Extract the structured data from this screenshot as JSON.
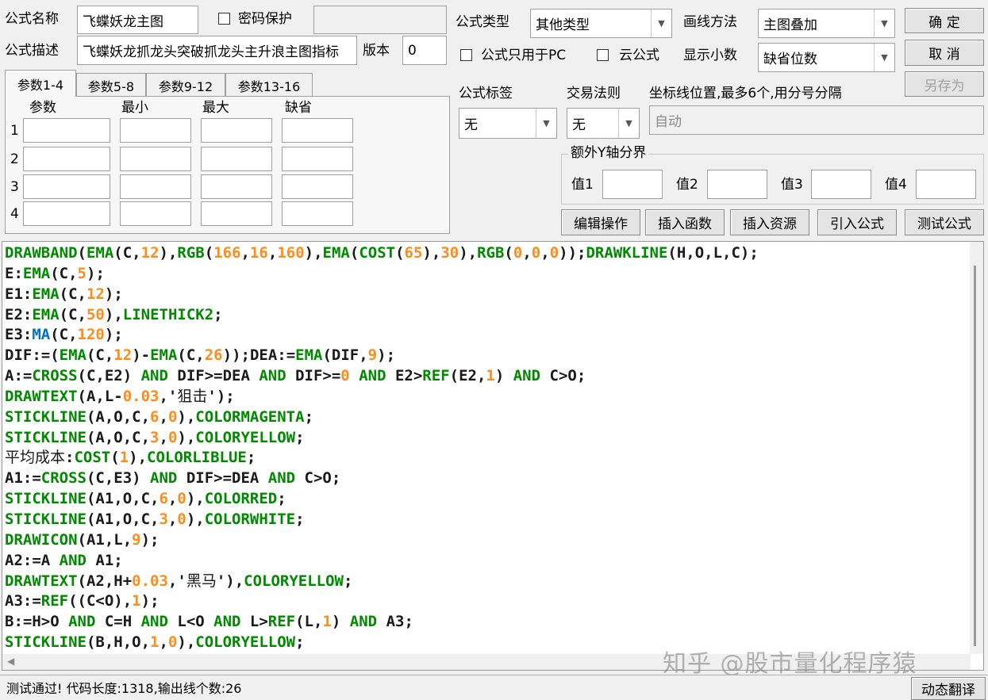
{
  "header": {
    "formula_name_label": "公式名称",
    "formula_name_value": "飞蝶妖龙主图",
    "password_label": "密码保护",
    "password_value": "",
    "formula_desc_label": "公式描述",
    "formula_desc_value": "飞蝶妖龙抓龙头突破抓龙头主升浪主图指标",
    "version_label": "版本",
    "version_value": "0",
    "formula_type_label": "公式类型",
    "formula_type_value": "其他类型",
    "draw_method_label": "画线方法",
    "draw_method_value": "主图叠加",
    "pc_only_label": "公式只用于PC",
    "cloud_label": "云公式",
    "decimal_label": "显示小数",
    "decimal_value": "缺省位数"
  },
  "buttons": {
    "ok": "确  定",
    "cancel": "取  消",
    "save_as": "另存为",
    "edit_ops": "编辑操作",
    "insert_func": "插入函数",
    "insert_res": "插入资源",
    "import_formula": "引入公式",
    "test_formula": "测试公式",
    "dynamic_translate": "动态翻译"
  },
  "params": {
    "tabs": [
      "参数1-4",
      "参数5-8",
      "参数9-12",
      "参数13-16"
    ],
    "headers": [
      "参数",
      "最小",
      "最大",
      "缺省"
    ],
    "rows": [
      "1",
      "2",
      "3",
      "4"
    ]
  },
  "right": {
    "tag_label": "公式标签",
    "tag_value": "无",
    "rule_label": "交易法则",
    "rule_value": "无",
    "axis_label": "坐标线位置,最多6个,用分号分隔",
    "axis_value": "自动",
    "extra_y_label": "额外Y轴分界",
    "value_labels": [
      "值1",
      "值2",
      "值3",
      "值4"
    ]
  },
  "code_lines": [
    [
      [
        "k",
        "DRAWBAND"
      ],
      [
        "t",
        "("
      ],
      [
        "k",
        "EMA"
      ],
      [
        "t",
        "(C,"
      ],
      [
        "n",
        "12"
      ],
      [
        "t",
        "),"
      ],
      [
        "k",
        "RGB"
      ],
      [
        "t",
        "("
      ],
      [
        "n",
        "166"
      ],
      [
        "t",
        ","
      ],
      [
        "n",
        "16"
      ],
      [
        "t",
        ","
      ],
      [
        "n",
        "160"
      ],
      [
        "t",
        "),"
      ],
      [
        "k",
        "EMA"
      ],
      [
        "t",
        "("
      ],
      [
        "k",
        "COST"
      ],
      [
        "t",
        "("
      ],
      [
        "n",
        "65"
      ],
      [
        "t",
        "),"
      ],
      [
        "n",
        "30"
      ],
      [
        "t",
        "),"
      ],
      [
        "k",
        "RGB"
      ],
      [
        "t",
        "("
      ],
      [
        "n",
        "0"
      ],
      [
        "t",
        ","
      ],
      [
        "n",
        "0"
      ],
      [
        "t",
        ","
      ],
      [
        "n",
        "0"
      ],
      [
        "t",
        "));"
      ],
      [
        "k",
        "DRAWKLINE"
      ],
      [
        "t",
        "(H,O,L,C);"
      ]
    ],
    [
      [
        "t",
        "E:"
      ],
      [
        "k",
        "EMA"
      ],
      [
        "t",
        "(C,"
      ],
      [
        "n",
        "5"
      ],
      [
        "t",
        ");"
      ]
    ],
    [
      [
        "t",
        "E1:"
      ],
      [
        "k",
        "EMA"
      ],
      [
        "t",
        "(C,"
      ],
      [
        "n",
        "12"
      ],
      [
        "t",
        ");"
      ]
    ],
    [
      [
        "t",
        "E2:"
      ],
      [
        "k",
        "EMA"
      ],
      [
        "t",
        "(C,"
      ],
      [
        "n",
        "50"
      ],
      [
        "t",
        "),"
      ],
      [
        "k",
        "LINETHICK2"
      ],
      [
        "t",
        ";"
      ]
    ],
    [
      [
        "t",
        "E3:"
      ],
      [
        "b",
        "MA"
      ],
      [
        "t",
        "(C,"
      ],
      [
        "n",
        "120"
      ],
      [
        "t",
        ");"
      ]
    ],
    [
      [
        "t",
        "DIF:=("
      ],
      [
        "k",
        "EMA"
      ],
      [
        "t",
        "(C,"
      ],
      [
        "n",
        "12"
      ],
      [
        "t",
        ")-"
      ],
      [
        "k",
        "EMA"
      ],
      [
        "t",
        "(C,"
      ],
      [
        "n",
        "26"
      ],
      [
        "t",
        "));DEA:="
      ],
      [
        "k",
        "EMA"
      ],
      [
        "t",
        "(DIF,"
      ],
      [
        "n",
        "9"
      ],
      [
        "t",
        ");"
      ]
    ],
    [
      [
        "t",
        "A:="
      ],
      [
        "k",
        "CROSS"
      ],
      [
        "t",
        "(C,E2) "
      ],
      [
        "k",
        "AND"
      ],
      [
        "t",
        " DIF>=DEA "
      ],
      [
        "k",
        "AND"
      ],
      [
        "t",
        " DIF>="
      ],
      [
        "n",
        "0"
      ],
      [
        "t",
        " "
      ],
      [
        "k",
        "AND"
      ],
      [
        "t",
        " E2>"
      ],
      [
        "k",
        "REF"
      ],
      [
        "t",
        "(E2,"
      ],
      [
        "n",
        "1"
      ],
      [
        "t",
        ") "
      ],
      [
        "k",
        "AND"
      ],
      [
        "t",
        " C>O;"
      ]
    ],
    [
      [
        "k",
        "DRAWTEXT"
      ],
      [
        "t",
        "(A,L-"
      ],
      [
        "n",
        "0.03"
      ],
      [
        "t",
        ",'"
      ],
      [
        "tc",
        "狙击"
      ],
      [
        "t",
        "');"
      ]
    ],
    [
      [
        "k",
        "STICKLINE"
      ],
      [
        "t",
        "(A,O,C,"
      ],
      [
        "n",
        "6"
      ],
      [
        "t",
        ","
      ],
      [
        "n",
        "0"
      ],
      [
        "t",
        "),"
      ],
      [
        "k",
        "COLORMAGENTA"
      ],
      [
        "t",
        ";"
      ]
    ],
    [
      [
        "k",
        "STICKLINE"
      ],
      [
        "t",
        "(A,O,C,"
      ],
      [
        "n",
        "3"
      ],
      [
        "t",
        ","
      ],
      [
        "n",
        "0"
      ],
      [
        "t",
        "),"
      ],
      [
        "k",
        "COLORYELLOW"
      ],
      [
        "t",
        ";"
      ]
    ],
    [
      [
        "tc",
        "平均成本"
      ],
      [
        "t",
        ":"
      ],
      [
        "k",
        "COST"
      ],
      [
        "t",
        "("
      ],
      [
        "n",
        "1"
      ],
      [
        "t",
        "),"
      ],
      [
        "k",
        "COLORLIBLUE"
      ],
      [
        "t",
        ";"
      ]
    ],
    [
      [
        "t",
        "A1:="
      ],
      [
        "k",
        "CROSS"
      ],
      [
        "t",
        "(C,E3) "
      ],
      [
        "k",
        "AND"
      ],
      [
        "t",
        " DIF>=DEA "
      ],
      [
        "k",
        "AND"
      ],
      [
        "t",
        " C>O;"
      ]
    ],
    [
      [
        "k",
        "STICKLINE"
      ],
      [
        "t",
        "(A1,O,C,"
      ],
      [
        "n",
        "6"
      ],
      [
        "t",
        ","
      ],
      [
        "n",
        "0"
      ],
      [
        "t",
        "),"
      ],
      [
        "k",
        "COLORRED"
      ],
      [
        "t",
        ";"
      ]
    ],
    [
      [
        "k",
        "STICKLINE"
      ],
      [
        "t",
        "(A1,O,C,"
      ],
      [
        "n",
        "3"
      ],
      [
        "t",
        ","
      ],
      [
        "n",
        "0"
      ],
      [
        "t",
        "),"
      ],
      [
        "k",
        "COLORWHITE"
      ],
      [
        "t",
        ";"
      ]
    ],
    [
      [
        "k",
        "DRAWICON"
      ],
      [
        "t",
        "(A1,L,"
      ],
      [
        "n",
        "9"
      ],
      [
        "t",
        ");"
      ]
    ],
    [
      [
        "t",
        "A2:=A "
      ],
      [
        "k",
        "AND"
      ],
      [
        "t",
        " A1;"
      ]
    ],
    [
      [
        "k",
        "DRAWTEXT"
      ],
      [
        "t",
        "(A2,H+"
      ],
      [
        "n",
        "0.03"
      ],
      [
        "t",
        ",'"
      ],
      [
        "tc",
        "黑马"
      ],
      [
        "t",
        "'),"
      ],
      [
        "k",
        "COLORYELLOW"
      ],
      [
        "t",
        ";"
      ]
    ],
    [
      [
        "t",
        "A3:="
      ],
      [
        "k",
        "REF"
      ],
      [
        "t",
        "((C<O),"
      ],
      [
        "n",
        "1"
      ],
      [
        "t",
        ");"
      ]
    ],
    [
      [
        "t",
        "B:=H>O "
      ],
      [
        "k",
        "AND"
      ],
      [
        "t",
        " C=H "
      ],
      [
        "k",
        "AND"
      ],
      [
        "t",
        " L<O "
      ],
      [
        "k",
        "AND"
      ],
      [
        "t",
        " L>"
      ],
      [
        "k",
        "REF"
      ],
      [
        "t",
        "(L,"
      ],
      [
        "n",
        "1"
      ],
      [
        "t",
        ") "
      ],
      [
        "k",
        "AND"
      ],
      [
        "t",
        " A3;"
      ]
    ],
    [
      [
        "k",
        "STICKLINE"
      ],
      [
        "t",
        "(B,H,O,"
      ],
      [
        "n",
        "1"
      ],
      [
        "t",
        ","
      ],
      [
        "n",
        "0"
      ],
      [
        "t",
        "),"
      ],
      [
        "k",
        "COLORYELLOW"
      ],
      [
        "t",
        ";"
      ]
    ]
  ],
  "status_text": "测试通过! 代码长度:1318,输出线个数:26",
  "watermark": "知乎 @股市量化程序猿"
}
